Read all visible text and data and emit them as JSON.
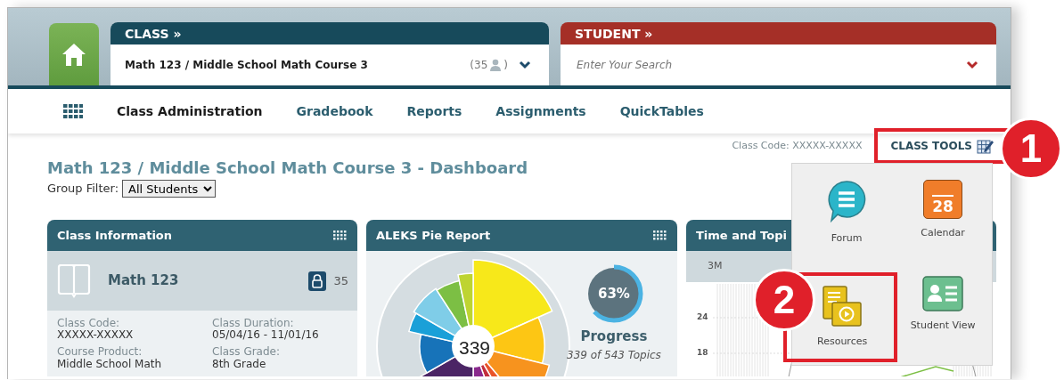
{
  "header": {
    "class_panel": {
      "label": "CLASS »",
      "value": "Math 123 / Middle School Math Course 3",
      "count_open": "(35",
      "count_close": ")"
    },
    "student_panel": {
      "label": "STUDENT »",
      "placeholder": "Enter Your Search"
    }
  },
  "nav": [
    {
      "label": "Class Administration",
      "selected": true
    },
    {
      "label": "Gradebook",
      "selected": false
    },
    {
      "label": "Reports",
      "selected": false
    },
    {
      "label": "Assignments",
      "selected": false
    },
    {
      "label": "QuickTables",
      "selected": false
    }
  ],
  "class_code": "Class Code: XXXXX-XXXXX",
  "class_tools": {
    "label": "CLASS TOOLS",
    "callout": "1"
  },
  "page_title": "Math 123 / Middle School Math Course 3 - Dashboard",
  "group_filter": {
    "label": "Group Filter:",
    "value": "All Students"
  },
  "class_info": {
    "title": "Class Information",
    "name": "Math 123",
    "count": "35",
    "fields": [
      {
        "label": "Class Code:",
        "value": "XXXXX-XXXXX"
      },
      {
        "label": "Class Duration:",
        "value": "05/04/16 - 11/01/16"
      },
      {
        "label": "Course Product:",
        "value": "Middle School Math"
      },
      {
        "label": "Class Grade:",
        "value": "8th Grade"
      }
    ]
  },
  "pie_report": {
    "title": "ALEKS Pie Report",
    "center": "339",
    "progress": {
      "percent": "63%",
      "level": 0.63,
      "label": "Progress",
      "detail": "339 of 543 Topics"
    }
  },
  "time_topics": {
    "title": "Time and Topi",
    "tabs": [
      "3M"
    ],
    "y_ticks": [
      "24",
      "18"
    ]
  },
  "tools_menu": [
    {
      "kind": "forum",
      "label": "Forum"
    },
    {
      "kind": "calendar",
      "label": "Calendar",
      "day": "28"
    },
    {
      "kind": "resources",
      "label": "Resources",
      "callout": "2"
    },
    {
      "kind": "student_view",
      "label": "Student View"
    }
  ]
}
